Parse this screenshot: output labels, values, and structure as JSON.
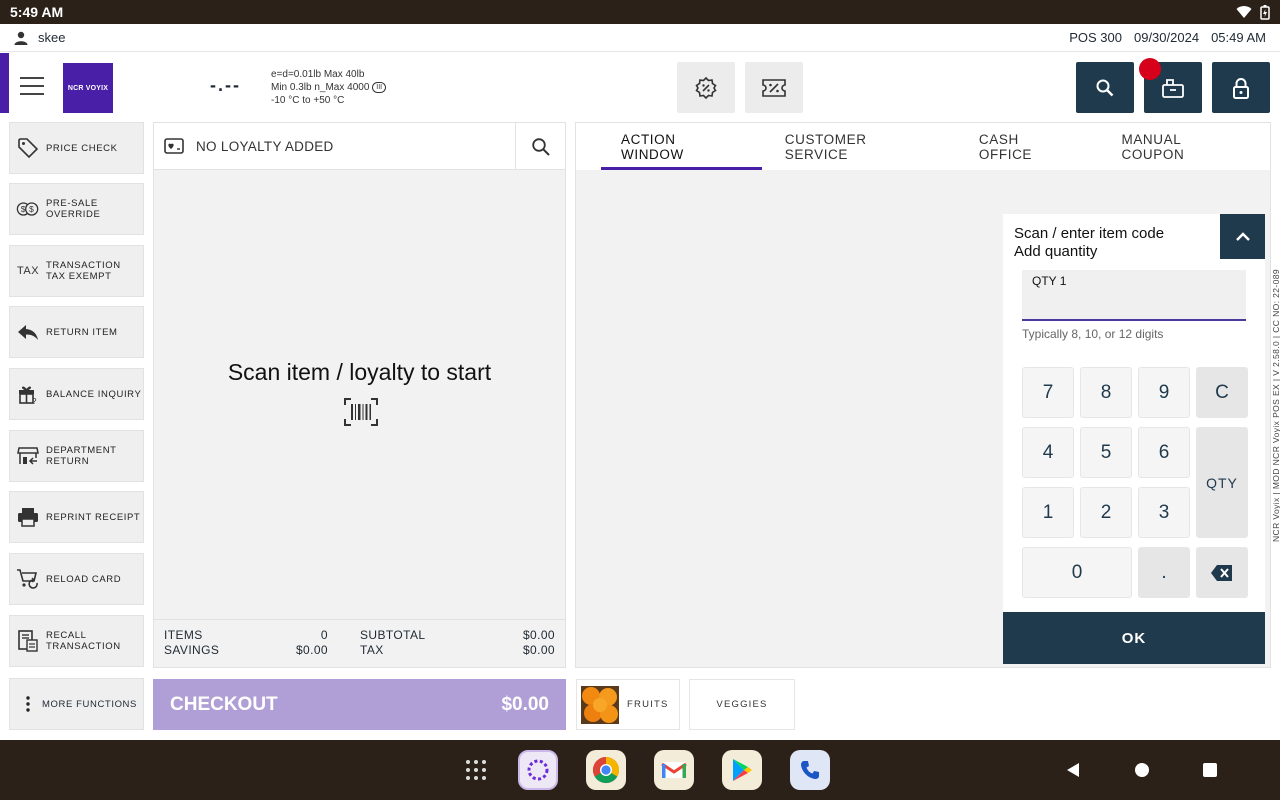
{
  "status_bar": {
    "time": "5:49 AM",
    "icons": [
      "wifi-icon",
      "battery-icon"
    ]
  },
  "user_bar": {
    "username": "skee",
    "terminal": "POS 300",
    "date": "09/30/2024",
    "time": "05:49 AM"
  },
  "header": {
    "logo_text": "NCR VOYIX",
    "scale_reading": "-.--",
    "scale_info": {
      "line1": "e=d=0.01lb Max 40lb",
      "line2": "Min 0.3lb n_Max 4000",
      "line3": "-10 °C to +50 °C",
      "badge": "III"
    },
    "icons": {
      "discount": "discount-badge-icon",
      "coupon": "coupon-ticket-icon",
      "search": "search-icon",
      "register": "cash-register-icon",
      "lock": "lock-icon"
    }
  },
  "functions": [
    {
      "label_line1": "PRICE CHECK",
      "label_line2": "",
      "icon": "price-tag-icon"
    },
    {
      "label_line1": "PRE-SALE",
      "label_line2": "OVERRIDE",
      "icon": "coins-icon"
    },
    {
      "label_line1": "TRANSACTION",
      "label_line2": "TAX EXEMPT",
      "icon": "tax-icon",
      "icon_text": "TAX"
    },
    {
      "label_line1": "RETURN ITEM",
      "label_line2": "",
      "icon": "return-arrow-icon"
    },
    {
      "label_line1": "BALANCE INQUIRY",
      "label_line2": "",
      "icon": "gift-card-icon"
    },
    {
      "label_line1": "DEPARTMENT",
      "label_line2": "RETURN",
      "icon": "store-return-icon"
    },
    {
      "label_line1": "REPRINT RECEIPT",
      "label_line2": "",
      "icon": "printer-icon"
    },
    {
      "label_line1": "RELOAD CARD",
      "label_line2": "",
      "icon": "cart-reload-icon"
    },
    {
      "label_line1": "RECALL",
      "label_line2": "TRANSACTION",
      "icon": "recall-receipt-icon"
    }
  ],
  "more_functions": "MORE FUNCTIONS",
  "transaction": {
    "loyalty_text": "NO LOYALTY ADDED",
    "scan_message": "Scan item / loyalty to start",
    "totals": {
      "items_label": "ITEMS",
      "items_value": "0",
      "savings_label": "SAVINGS",
      "savings_value": "$0.00",
      "subtotal_label": "SUBTOTAL",
      "subtotal_value": "$0.00",
      "tax_label": "TAX",
      "tax_value": "$0.00"
    }
  },
  "checkout": {
    "label": "CHECKOUT",
    "amount": "$0.00"
  },
  "tabs": [
    {
      "label": "ACTION WINDOW",
      "active": true
    },
    {
      "label": "CUSTOMER SERVICE",
      "active": false
    },
    {
      "label": "CASH OFFICE",
      "active": false
    },
    {
      "label": "MANUAL COUPON",
      "active": false
    }
  ],
  "keypad": {
    "title_line1": "Scan / enter item code",
    "title_line2": "Add quantity",
    "field_value": "QTY 1",
    "hint": "Typically 8, 10, or 12 digits",
    "keys": {
      "k7": "7",
      "k8": "8",
      "k9": "9",
      "clear": "C",
      "k4": "4",
      "k5": "5",
      "k6": "6",
      "qty": "QTY",
      "k1": "1",
      "k2": "2",
      "k3": "3",
      "k0": "0",
      "dot": "."
    },
    "ok": "OK"
  },
  "vertical_info": "NCR Voyix | MOD NCR Voyix POS EX | V 2.58.0 | CC NO: 22-089",
  "quick_buttons": {
    "fruits": "FRUITS",
    "veggies": "VEGGIES"
  },
  "nav_bar": {
    "apps": [
      "app-grid-icon",
      "purple-app-icon",
      "chrome-icon",
      "gmail-icon",
      "play-store-icon",
      "phone-icon"
    ],
    "nav": [
      "back-icon",
      "home-icon",
      "recents-icon"
    ]
  }
}
